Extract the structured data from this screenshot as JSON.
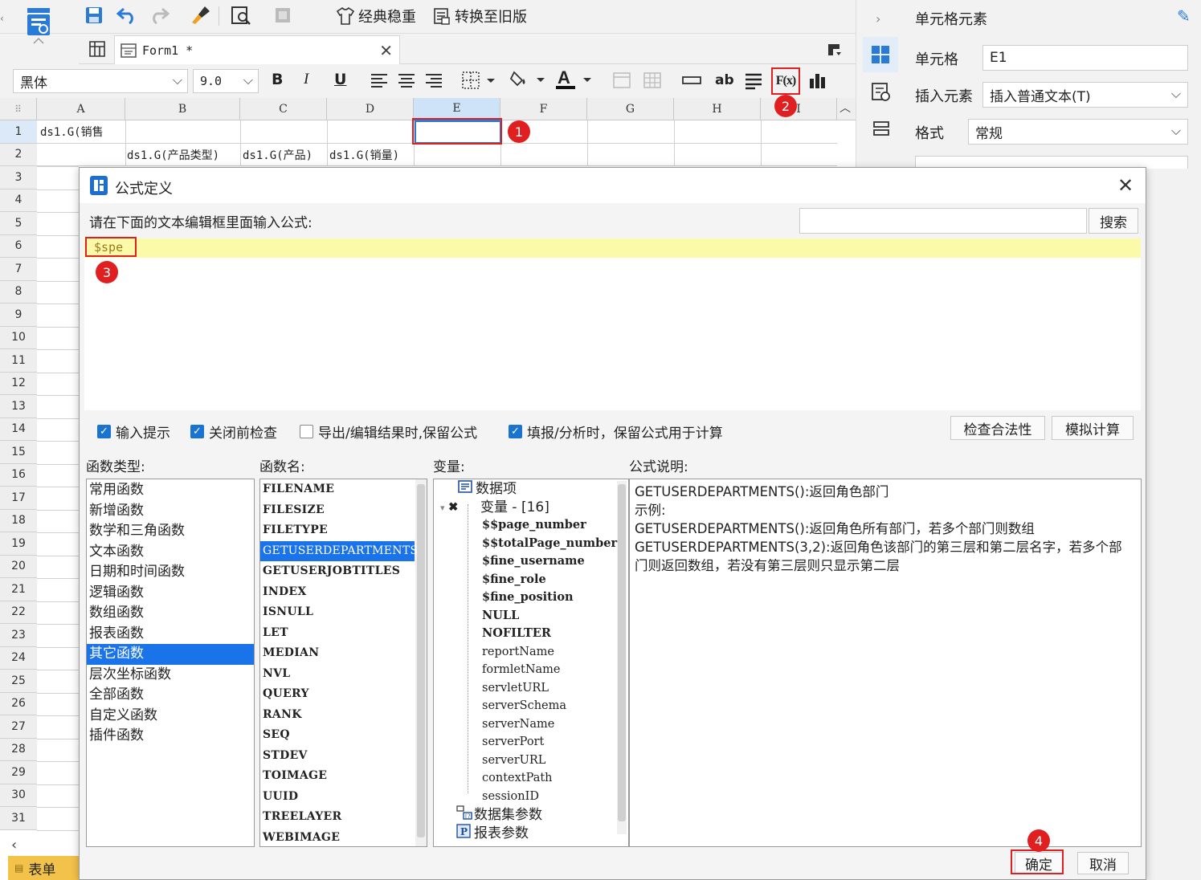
{
  "toolbar": {
    "classic_label": "经典稳重",
    "convert_label": "转换至旧版"
  },
  "tabs": {
    "form_tab": "Form1 *"
  },
  "format_bar": {
    "font": "黑体",
    "size": "9.0",
    "bold": "B",
    "italic": "I",
    "underline": "U",
    "ab": "ab",
    "fx": "F(x)"
  },
  "grid": {
    "columns": [
      "A",
      "B",
      "C",
      "D",
      "E",
      "F",
      "G",
      "H",
      "I"
    ],
    "rows": [
      "1",
      "2",
      "3",
      "4",
      "5",
      "6",
      "7",
      "8",
      "9",
      "10",
      "11",
      "12",
      "13",
      "14",
      "15",
      "16",
      "17",
      "18",
      "19",
      "20",
      "21",
      "22",
      "23",
      "24",
      "25",
      "26",
      "27",
      "28",
      "29",
      "30",
      "31"
    ],
    "a1": "ds1.G(销售",
    "b2": "ds1.G(产品类型)",
    "c2": "ds1.G(产品)",
    "d2": "ds1.G(销量)",
    "sheet_tab": "表单"
  },
  "right_panel": {
    "title": "单元格元素",
    "cell_label": "单元格",
    "cell_value": "E1",
    "insert_label": "插入元素",
    "insert_value": "插入普通文本(T)",
    "format_label": "格式",
    "format_value": "常规"
  },
  "dialog": {
    "title": "公式定义",
    "prompt": "请在下面的文本编辑框里面输入公式:",
    "search_button": "搜索",
    "formula": "$spe",
    "options": [
      {
        "label": "输入提示",
        "checked": true
      },
      {
        "label": "关闭前检查",
        "checked": true
      },
      {
        "label": "导出/编辑结果时,保留公式",
        "checked": false
      },
      {
        "label": "填报/分析时，保留公式用于计算",
        "checked": true
      }
    ],
    "check_button": "检查合法性",
    "simulate_button": "模拟计算",
    "func_type_label": "函数类型:",
    "func_name_label": "函数名:",
    "var_label": "变量:",
    "desc_label": "公式说明:",
    "func_types": [
      "常用函数",
      "新增函数",
      "数学和三角函数",
      "文本函数",
      "日期和时间函数",
      "逻辑函数",
      "数组函数",
      "报表函数",
      "其它函数",
      "层次坐标函数",
      "全部函数",
      "自定义函数",
      "插件函数"
    ],
    "func_names": [
      "FILENAME",
      "FILESIZE",
      "FILETYPE",
      "GETUSERDEPARTMENTS",
      "GETUSERJOBTITLES",
      "INDEX",
      "ISNULL",
      "LET",
      "MEDIAN",
      "NVL",
      "QUERY",
      "RANK",
      "SEQ",
      "STDEV",
      "TOIMAGE",
      "UUID",
      "TREELAYER",
      "WEBIMAGE"
    ],
    "var_data_items": "数据项",
    "var_group": "变量 - [16]",
    "variables": [
      "$$page_number",
      "$$totalPage_number",
      "$fine_username",
      "$fine_role",
      "$fine_position",
      "NULL",
      "NOFILTER",
      "reportName",
      "formletName",
      "servletURL",
      "serverSchema",
      "serverName",
      "serverPort",
      "serverURL",
      "contextPath",
      "sessionID"
    ],
    "var_dataset_params": "数据集参数",
    "var_report_params": "报表参数",
    "desc_lines": [
      "GETUSERDEPARTMENTS():返回角色部门",
      "示例:",
      "GETUSERDEPARTMENTS():返回角色所有部门，若多个部门则数组",
      "GETUSERDEPARTMENTS(3,2):返回角色该部门的第三层和第二层名字，若多个部",
      "门则返回数组，若没有第三层则只显示第二层"
    ],
    "ok_button": "确定",
    "cancel_button": "取消"
  },
  "badges": [
    "1",
    "2",
    "3",
    "4"
  ]
}
